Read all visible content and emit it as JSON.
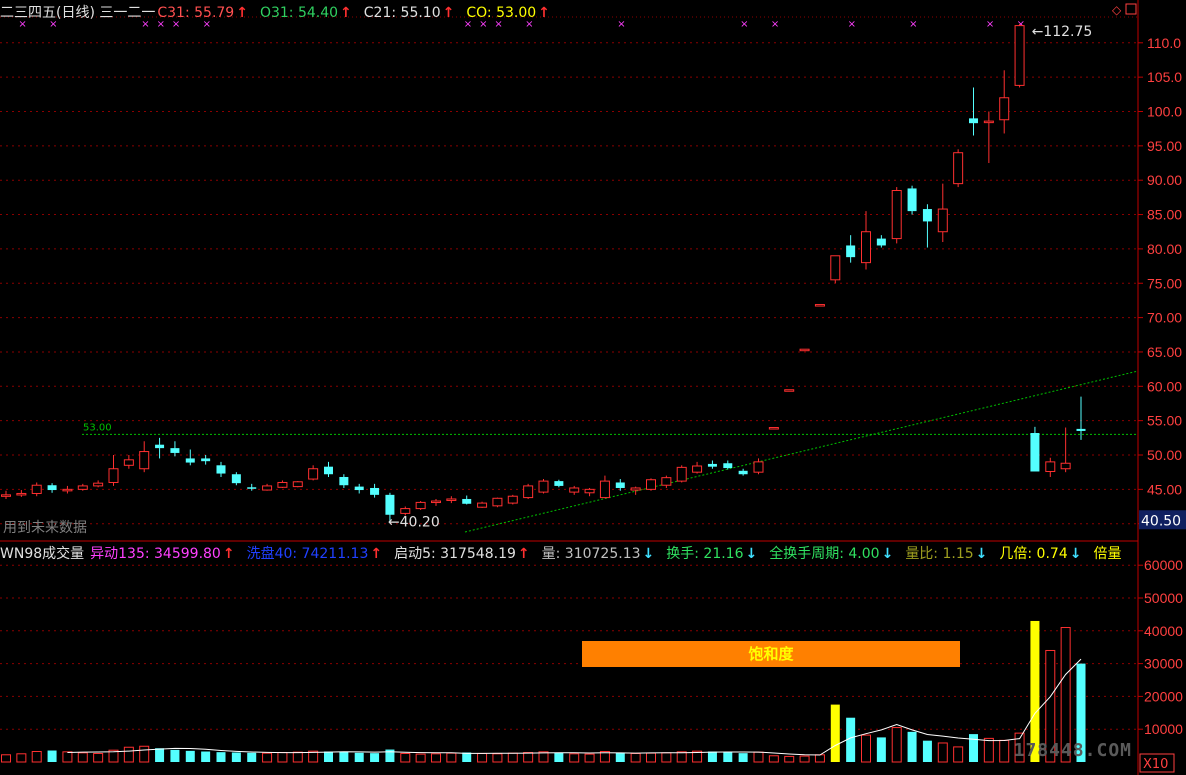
{
  "header": {
    "title": "二三四五(日线) 三一二一",
    "indicators": [
      {
        "label": "C31: 55.79",
        "color": "#ff5050",
        "arrow": "↑",
        "arrow_color": "#ff3030"
      },
      {
        "label": "O31: 54.40",
        "color": "#30d060",
        "arrow": "↑",
        "arrow_color": "#ff3030"
      },
      {
        "label": "C21: 55.10",
        "color": "#e0e0e0",
        "arrow": "↑",
        "arrow_color": "#ff3030"
      },
      {
        "label": "CO: 53.00",
        "color": "#ffff00",
        "arrow": "↑",
        "arrow_color": "#ff3030"
      }
    ]
  },
  "volume_header": {
    "title": "WN98成交量",
    "indicators": [
      {
        "label": "异动135: 34599.80",
        "color": "#ff40ff",
        "arrow": "↑",
        "arrow_color": "#ff3030"
      },
      {
        "label": "洗盘40: 74211.13",
        "color": "#2040ff",
        "arrow": "↑",
        "arrow_color": "#ff3030"
      },
      {
        "label": "启动5: 317548.19",
        "color": "#e0e0e0",
        "arrow": "↑",
        "arrow_color": "#ff3030"
      },
      {
        "label": "量: 310725.13",
        "color": "#c0c0c0",
        "arrow": "↓",
        "arrow_color": "#40e0ff"
      },
      {
        "label": "换手: 21.16",
        "color": "#30e060",
        "arrow": "↓",
        "arrow_color": "#40e0ff"
      },
      {
        "label": "全换手周期: 4.00",
        "color": "#30e060",
        "arrow": "↓",
        "arrow_color": "#40e0ff"
      },
      {
        "label": "量比: 1.15",
        "color": "#a0a020",
        "arrow": "↓",
        "arrow_color": "#40e0ff"
      },
      {
        "label": "几倍: 0.74",
        "color": "#ffff00",
        "arrow": "↓",
        "arrow_color": "#40e0ff"
      },
      {
        "label": "倍量",
        "color": "#ffff00",
        "arrow": "",
        "arrow_color": "#40e0ff"
      }
    ]
  },
  "saturation_label": "饱和度",
  "future_data_label": "用到未来数据",
  "watermark": "178448.COM",
  "scale_label": "X10",
  "current_price_tag": "40.50",
  "colors": {
    "up": "#ff3030",
    "down": "#54ffff",
    "grid": "#8b0000",
    "axis": "#c00000",
    "support": "#00c000",
    "trend": "#00c000"
  },
  "chart_data": {
    "type": "candlestick",
    "price_axis": {
      "min": 40,
      "max": 110,
      "ticks": [
        "40.00",
        "45.00",
        "50.00",
        "55.00",
        "60.00",
        "65.00",
        "70.00",
        "75.00",
        "80.00",
        "85.00",
        "90.00",
        "95.00",
        "100.0",
        "105.0",
        "110.0"
      ]
    },
    "volume_axis": {
      "min": 0,
      "max": 60000,
      "ticks": [
        "10000",
        "20000",
        "30000",
        "40000",
        "50000",
        "60000"
      ]
    },
    "annotations": {
      "high_label": "112.75",
      "low_label": "40.20",
      "support_label": "53.00",
      "support_value": 53.0
    },
    "candles": [
      [
        44.0,
        44.8,
        43.6,
        44.2
      ],
      [
        44.2,
        44.9,
        43.9,
        44.4
      ],
      [
        44.4,
        46.0,
        44.0,
        45.6
      ],
      [
        45.6,
        45.9,
        44.5,
        44.9
      ],
      [
        44.9,
        45.5,
        44.4,
        45.0
      ],
      [
        45.0,
        45.8,
        44.8,
        45.5
      ],
      [
        45.5,
        46.3,
        45.3,
        45.9
      ],
      [
        46.0,
        50.0,
        45.5,
        48.0
      ],
      [
        48.5,
        50.0,
        48.0,
        49.3
      ],
      [
        48.0,
        52.0,
        47.5,
        50.5
      ],
      [
        51.5,
        52.5,
        49.5,
        51.0
      ],
      [
        51.0,
        52.0,
        49.8,
        50.3
      ],
      [
        49.5,
        50.8,
        48.5,
        48.9
      ],
      [
        49.5,
        50.0,
        48.6,
        49.1
      ],
      [
        48.5,
        49.0,
        46.8,
        47.3
      ],
      [
        47.2,
        47.5,
        45.6,
        45.9
      ],
      [
        45.3,
        45.8,
        44.8,
        45.1
      ],
      [
        44.9,
        45.8,
        44.8,
        45.5
      ],
      [
        45.3,
        46.3,
        45.2,
        46.0
      ],
      [
        45.4,
        46.2,
        45.3,
        46.1
      ],
      [
        46.5,
        48.5,
        46.3,
        48.0
      ],
      [
        48.3,
        49.0,
        46.8,
        47.2
      ],
      [
        46.8,
        47.2,
        45.2,
        45.6
      ],
      [
        45.4,
        45.8,
        44.4,
        44.9
      ],
      [
        45.2,
        45.8,
        43.8,
        44.2
      ],
      [
        44.2,
        44.5,
        40.2,
        41.3
      ],
      [
        41.5,
        42.5,
        41.2,
        42.2
      ],
      [
        42.2,
        43.3,
        42.0,
        43.1
      ],
      [
        43.2,
        43.6,
        42.6,
        43.3
      ],
      [
        43.4,
        44.0,
        43.0,
        43.6
      ],
      [
        43.6,
        44.1,
        42.8,
        42.9
      ],
      [
        42.4,
        43.2,
        42.3,
        43.0
      ],
      [
        42.6,
        43.8,
        42.4,
        43.7
      ],
      [
        43.0,
        44.2,
        42.8,
        44.0
      ],
      [
        43.8,
        45.8,
        43.6,
        45.5
      ],
      [
        44.6,
        46.5,
        44.4,
        46.2
      ],
      [
        46.2,
        46.4,
        45.3,
        45.5
      ],
      [
        44.6,
        45.5,
        44.2,
        45.2
      ],
      [
        44.5,
        45.2,
        44.0,
        45.0
      ],
      [
        43.8,
        47.0,
        43.7,
        46.2
      ],
      [
        46.0,
        46.5,
        44.8,
        45.2
      ],
      [
        44.9,
        45.4,
        44.2,
        45.2
      ],
      [
        45.0,
        46.6,
        44.8,
        46.4
      ],
      [
        45.6,
        47.0,
        45.2,
        46.7
      ],
      [
        46.2,
        48.5,
        46.0,
        48.2
      ],
      [
        47.5,
        49.0,
        47.3,
        48.4
      ],
      [
        48.7,
        49.2,
        48.0,
        48.3
      ],
      [
        48.8,
        49.2,
        47.9,
        48.1
      ],
      [
        47.7,
        48.0,
        47.0,
        47.2
      ],
      [
        47.5,
        49.5,
        47.2,
        49.0
      ],
      [
        54.0,
        54.0,
        54.0,
        54.0
      ],
      [
        59.5,
        59.5,
        59.5,
        59.5
      ],
      [
        65.4,
        65.4,
        65.4,
        65.4
      ],
      [
        71.9,
        71.9,
        71.9,
        71.9
      ],
      [
        75.5,
        79.0,
        75.0,
        79.0
      ],
      [
        80.5,
        82.0,
        78.0,
        78.8
      ],
      [
        78.0,
        85.5,
        77.0,
        82.5
      ],
      [
        81.5,
        82.0,
        80.2,
        80.5
      ],
      [
        81.5,
        89.0,
        80.8,
        88.5
      ],
      [
        88.8,
        89.2,
        85.0,
        85.5
      ],
      [
        85.8,
        86.5,
        80.2,
        84.0
      ],
      [
        82.5,
        89.5,
        81.0,
        85.8
      ],
      [
        89.5,
        94.5,
        89.0,
        94.0
      ],
      [
        99.0,
        103.5,
        96.5,
        98.3
      ],
      [
        98.5,
        100.0,
        92.5,
        98.6
      ],
      [
        98.8,
        106.0,
        96.8,
        102.0
      ],
      [
        103.8,
        112.75,
        103.5,
        112.5
      ],
      [
        53.2,
        54.1,
        48.0,
        47.6
      ],
      [
        47.6,
        49.6,
        46.8,
        49.0
      ],
      [
        48.0,
        54.0,
        47.5,
        48.8
      ],
      [
        53.8,
        58.5,
        52.2,
        53.5
      ]
    ],
    "volumes": [
      2200,
      2500,
      3200,
      3500,
      3100,
      2800,
      2600,
      3600,
      4500,
      4800,
      4200,
      3700,
      3400,
      3200,
      3000,
      2900,
      2800,
      2700,
      2900,
      3000,
      3300,
      3200,
      3100,
      2800,
      2700,
      3800,
      2600,
      2400,
      2500,
      2700,
      2900,
      2600,
      2500,
      2700,
      2900,
      3100,
      2800,
      2500,
      2400,
      3200,
      2900,
      2600,
      2700,
      2800,
      3100,
      3300,
      3200,
      2900,
      2700,
      3000,
      1900,
      1700,
      1800,
      2200,
      17500,
      13500,
      8200,
      7500,
      10500,
      9200,
      6500,
      5800,
      4600,
      8500,
      7200,
      6600,
      8800,
      43000,
      34000,
      41000,
      30000
    ]
  }
}
